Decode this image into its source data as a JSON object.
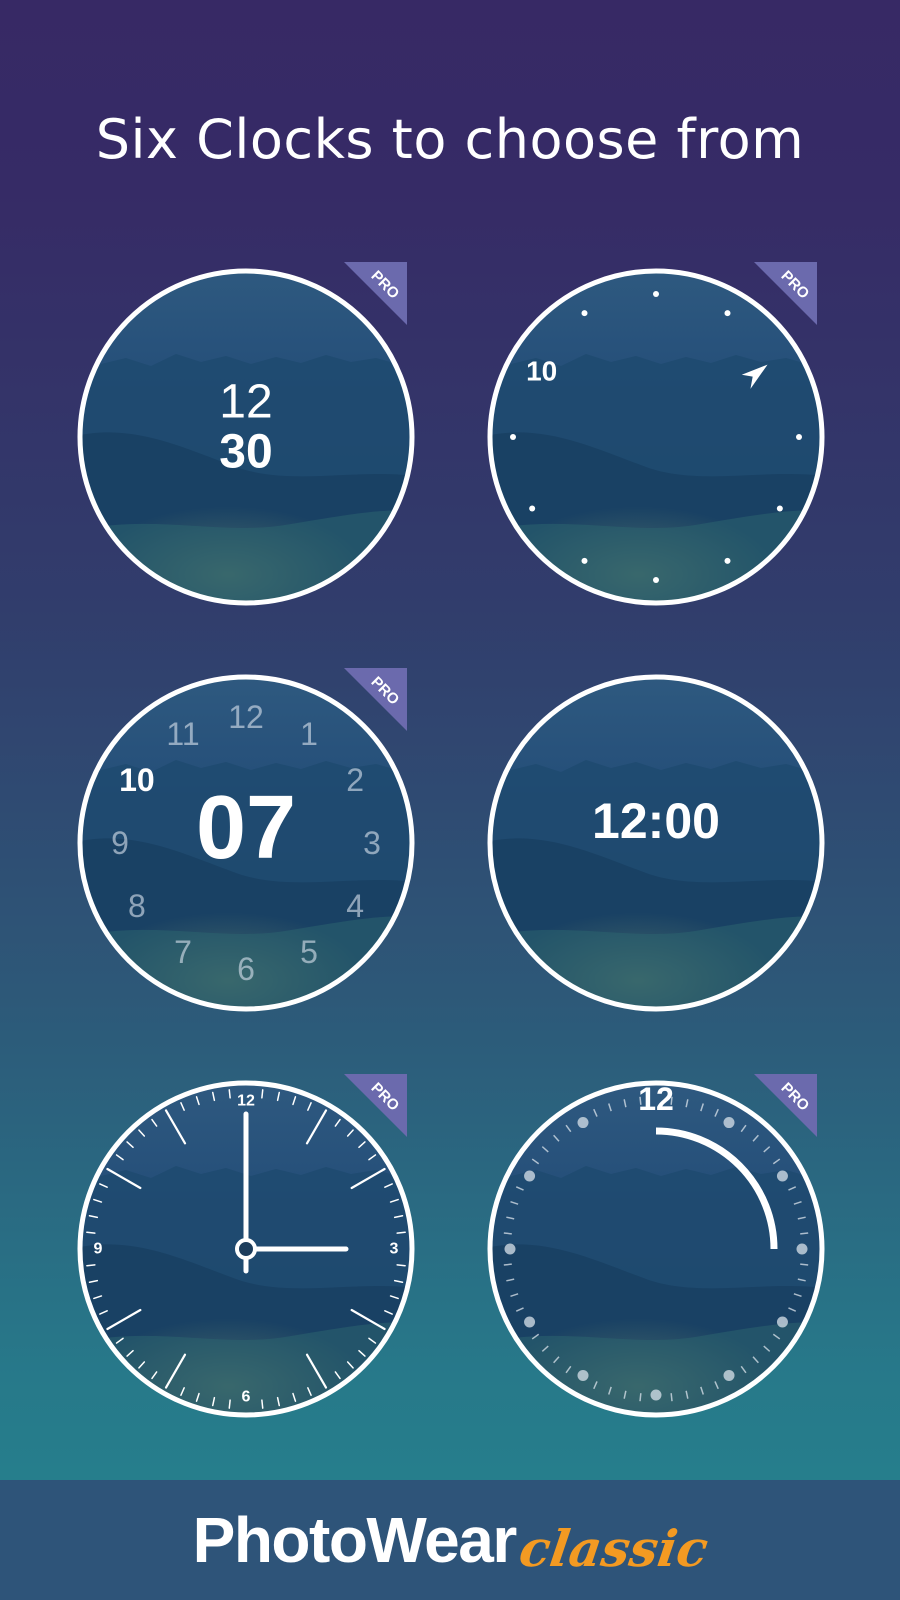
{
  "headline": "Six Clocks to choose from",
  "badge_label": "PRO",
  "colors": {
    "accent": "#f39a22",
    "badge": "#6b6aad",
    "footer": "#2e5479",
    "ring": "#ffffff"
  },
  "faces": [
    {
      "id": "digital-stacked",
      "pro": true,
      "hours": "12",
      "minutes": "30"
    },
    {
      "id": "dots-pointer",
      "pro": true,
      "hour_label": "10"
    },
    {
      "id": "big-minutes-ring",
      "pro": true,
      "minutes": "07",
      "current_hour": "10",
      "hours": [
        "12",
        "1",
        "2",
        "3",
        "4",
        "5",
        "6",
        "7",
        "8",
        "9",
        "10",
        "11"
      ]
    },
    {
      "id": "digital-simple",
      "pro": false,
      "time": "12:00"
    },
    {
      "id": "analog-classic",
      "pro": true,
      "labels": {
        "top": "12",
        "right": "3",
        "bottom": "6",
        "left": "9"
      },
      "hour": 3,
      "minute": 0
    },
    {
      "id": "arc-progress",
      "pro": true,
      "label": "12",
      "progress": 0.25
    }
  ],
  "footer": {
    "brand": "PhotoWear",
    "edition": "classic"
  }
}
